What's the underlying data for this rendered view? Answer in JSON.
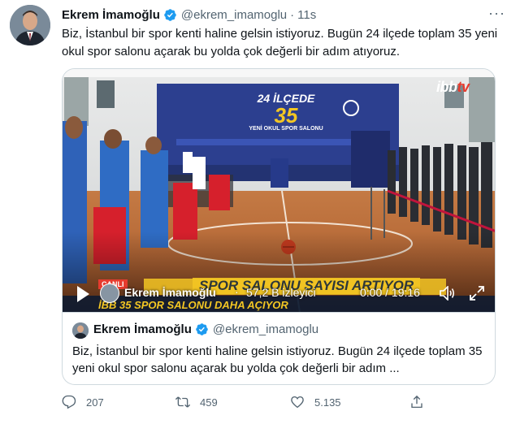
{
  "tweet": {
    "author_name": "Ekrem İmamoğlu",
    "handle": "@ekrem_imamoglu",
    "separator": "·",
    "time": "11s",
    "more_glyph": "···",
    "text": "Biz, İstanbul bir spor kenti haline gelsin istiyoruz. Bugün 24 ilçede toplam 35 yeni okul spor salonu açarak bu yolda çok değerli bir adım atıyoruz."
  },
  "video": {
    "channel_logo_main": "ibb",
    "channel_logo_accent": "tv",
    "banner_line1": "24 İLÇEDE",
    "banner_line2": "35",
    "banner_line3": "YENİ OKUL SPOR SALONU",
    "ticker_badge": "CANLI",
    "ticker_headline": "SPOR SALONU SAYISI ARTIYOR",
    "ticker_sub": "İBB 35 SPOR SALONU DAHA AÇIYOR",
    "overlay_name": "Ekrem İmamoğlu",
    "overlay_separator": "·",
    "views": "57,2 B izleyici",
    "time": "0:00 / 19:16"
  },
  "quoted": {
    "author_name": "Ekrem İmamoğlu",
    "handle": "@ekrem_imamoglu",
    "text": "Biz, İstanbul bir spor kenti haline gelsin istiyoruz. Bugün 24 ilçede toplam 35 yeni okul spor salonu açarak bu yolda çok değerli bir adım ..."
  },
  "actions": {
    "replies": "207",
    "retweets": "459",
    "likes": "5.135"
  },
  "colors": {
    "verified": "#1d9bf0",
    "secondary_text": "#536471",
    "court_floor": "#b8693a",
    "banner_blue": "#2c3f8f",
    "ticker_yellow": "#f3c623"
  }
}
